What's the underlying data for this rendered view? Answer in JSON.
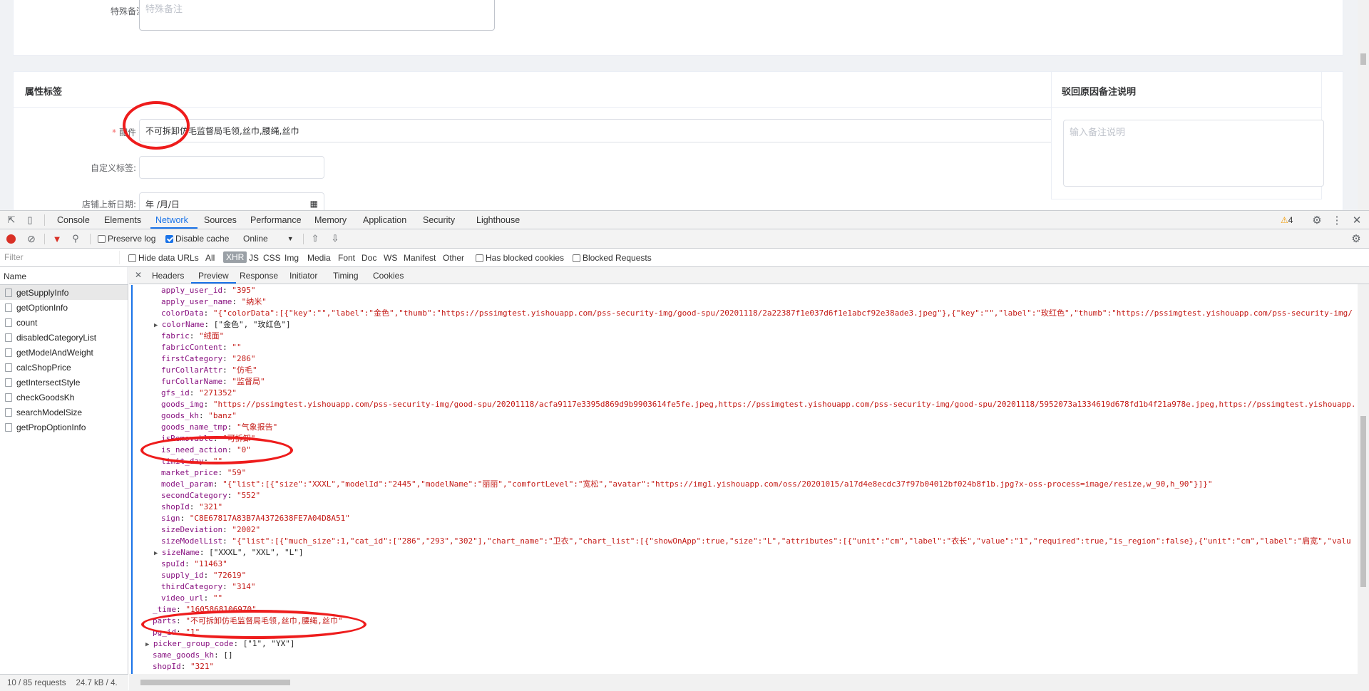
{
  "form": {
    "remark_label": "特殊备注",
    "remark_placeholder": "特殊备注",
    "attr_section_title": "属性标签",
    "parts_label": "配件",
    "parts_value": "不可拆卸仿毛监督局毛领,丝巾,腰绳,丝巾",
    "custom_tag_label": "自定义标签:",
    "shop_date_label": "店铺上新日期:",
    "shop_date_value": "年 /月/日",
    "reject_title": "驳回原因备注说明",
    "reject_placeholder": "输入备注说明"
  },
  "devtools": {
    "tabs": [
      "Console",
      "Elements",
      "Network",
      "Sources",
      "Performance",
      "Memory",
      "Application",
      "Security",
      "Lighthouse"
    ],
    "active_tab": "Network",
    "warnings": "4",
    "toolbar": {
      "preserve_log": "Preserve log",
      "disable_cache": "Disable cache",
      "throttle": "Online"
    },
    "filter": {
      "placeholder": "Filter",
      "hide_data_urls": "Hide data URLs",
      "types": [
        "All",
        "XHR",
        "JS",
        "CSS",
        "Img",
        "Media",
        "Font",
        "Doc",
        "WS",
        "Manifest",
        "Other"
      ],
      "active_type": "XHR",
      "has_blocked": "Has blocked cookies",
      "blocked_requests": "Blocked Requests"
    },
    "name_header": "Name",
    "requests": [
      "getSupplyInfo",
      "getOptionInfo",
      "count",
      "disabledCategoryList",
      "getModelAndWeight",
      "calcShopPrice",
      "getIntersectStyle",
      "checkGoodsKh",
      "searchModelSize",
      "getPropOptionInfo"
    ],
    "status_requests": "10 / 85 requests",
    "status_size": "24.7 kB / 4.",
    "detail_tabs": [
      "Headers",
      "Preview",
      "Response",
      "Initiator",
      "Timing",
      "Cookies"
    ],
    "active_detail_tab": "Preview",
    "preview_lines": [
      {
        "indent": 1,
        "key": "apply_user_id",
        "val": "\"395\""
      },
      {
        "indent": 1,
        "key": "apply_user_name",
        "val": "\"纳米\""
      },
      {
        "indent": 1,
        "key": "colorData",
        "val": "\"{\"colorData\":[{\"key\":\"\",\"label\":\"金色\",\"thumb\":\"https://pssimgtest.yishouapp.com/pss-security-img/good-spu/20201118/2a22387f1e037d6f1e1abcf92e38ade3.jpeg\"},{\"key\":\"\",\"label\":\"玫红色\",\"thumb\":\"https://pssimgtest.yishouapp.com/pss-security-img/"
      },
      {
        "indent": 1,
        "key": "colorName",
        "val": "[\"金色\", \"玫红色\"]",
        "tri": true,
        "plain": true
      },
      {
        "indent": 1,
        "key": "fabric",
        "val": "\"绒面\""
      },
      {
        "indent": 1,
        "key": "fabricContent",
        "val": "\"\""
      },
      {
        "indent": 1,
        "key": "firstCategory",
        "val": "\"286\""
      },
      {
        "indent": 1,
        "key": "furCollarAttr",
        "val": "\"仿毛\""
      },
      {
        "indent": 1,
        "key": "furCollarName",
        "val": "\"监督局\""
      },
      {
        "indent": 1,
        "key": "gfs_id",
        "val": "\"271352\""
      },
      {
        "indent": 1,
        "key": "goods_img",
        "val": "\"https://pssimgtest.yishouapp.com/pss-security-img/good-spu/20201118/acfa9117e3395d869d9b9903614fe5fe.jpeg,https://pssimgtest.yishouapp.com/pss-security-img/good-spu/20201118/5952073a1334619d678fd1b4f21a978e.jpeg,https://pssimgtest.yishouapp."
      },
      {
        "indent": 1,
        "key": "goods_kh",
        "val": "\"banz\""
      },
      {
        "indent": 1,
        "key": "goods_name_tmp",
        "val": "\"气象报告\""
      },
      {
        "indent": 1,
        "key": "isRemovable",
        "val": "\"可拆卸\""
      },
      {
        "indent": 1,
        "key": "is_need_action",
        "val": "\"0\""
      },
      {
        "indent": 1,
        "key": "limit_day",
        "val": "\"\""
      },
      {
        "indent": 1,
        "key": "market_price",
        "val": "\"59\""
      },
      {
        "indent": 1,
        "key": "model_param",
        "val": "\"{\"list\":[{\"size\":\"XXXL\",\"modelId\":\"2445\",\"modelName\":\"丽丽\",\"comfortLevel\":\"宽松\",\"avatar\":\"https://img1.yishouapp.com/oss/20201015/a17d4e8ecdc37f97b04012bf024b8f1b.jpg?x-oss-process=image/resize,w_90,h_90\"}]}\""
      },
      {
        "indent": 1,
        "key": "secondCategory",
        "val": "\"552\""
      },
      {
        "indent": 1,
        "key": "shopId",
        "val": "\"321\""
      },
      {
        "indent": 1,
        "key": "sign",
        "val": "\"C8E67817A83B7A4372638FE7A04D8A51\""
      },
      {
        "indent": 1,
        "key": "sizeDeviation",
        "val": "\"2002\""
      },
      {
        "indent": 1,
        "key": "sizeModelList",
        "val": "\"{\"list\":[{\"much_size\":1,\"cat_id\":[\"286\",\"293\",\"302\"],\"chart_name\":\"卫衣\",\"chart_list\":[{\"showOnApp\":true,\"size\":\"L\",\"attributes\":[{\"unit\":\"cm\",\"label\":\"衣长\",\"value\":\"1\",\"required\":true,\"is_region\":false},{\"unit\":\"cm\",\"label\":\"肩宽\",\"valu"
      },
      {
        "indent": 1,
        "key": "sizeName",
        "val": "[\"XXXL\", \"XXL\", \"L\"]",
        "tri": true,
        "plain": true
      },
      {
        "indent": 1,
        "key": "spuId",
        "val": "\"11463\""
      },
      {
        "indent": 1,
        "key": "supply_id",
        "val": "\"72619\""
      },
      {
        "indent": 1,
        "key": "thirdCategory",
        "val": "\"314\""
      },
      {
        "indent": 1,
        "key": "video_url",
        "val": "\"\""
      },
      {
        "indent": 0,
        "key": "_time",
        "val": "\"1605868106970\""
      },
      {
        "indent": 0,
        "key": "parts",
        "val": "\"不可拆卸仿毛监督局毛领,丝巾,腰绳,丝巾\""
      },
      {
        "indent": 0,
        "key": "pg_id",
        "val": "\"1\""
      },
      {
        "indent": 0,
        "key": "picker_group_code",
        "val": "[\"1\", \"YX\"]",
        "tri": true,
        "plain": true
      },
      {
        "indent": 0,
        "key": "same_goods_kh",
        "val": "[]",
        "plain": true
      },
      {
        "indent": 0,
        "key": "shopId",
        "val": "\"321\""
      }
    ]
  }
}
